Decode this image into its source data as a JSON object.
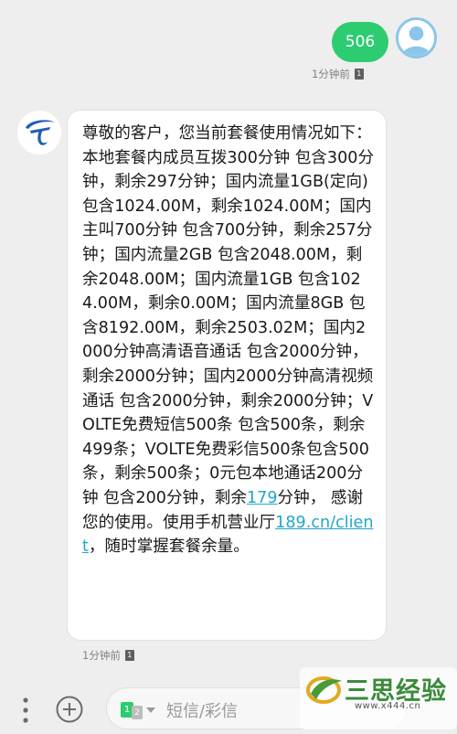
{
  "sent": {
    "text": "506",
    "time": "1分钟前",
    "sim": "1"
  },
  "received": {
    "segments": [
      {
        "t": "尊敬的客户，您当前套餐使用情况如下：本地套餐内成员互拨300分钟 包含300分钟，剩余297分钟；国内流量1GB(定向) 包含1024.00M，剩余1024.00M；国内主叫700分钟 包含700分钟，剩余257分钟；国内流量2GB 包含2048.00M，剩余2048.00M；国内流量1GB 包含1024.00M，剩余0.00M；国内流量8GB 包含8192.00M，剩余2503.02M；国内2000分钟高清语音通话 包含2000分钟，剩余2000分钟；国内2000分钟高清视频通话 包含2000分钟，剩余2000分钟；VOLTE免费短信500条 包含500条，剩余499条；VOLTE免费彩信500条包含500条，剩余500条；0元包本地通话200分钟 包含200分钟，剩余"
      },
      {
        "t": "179",
        "link": true
      },
      {
        "t": "分钟， 感谢您的使用。使用手机营业厅"
      },
      {
        "t": "189.cn/client",
        "link": true
      },
      {
        "t": "，随时掌握套餐余量。"
      }
    ],
    "time": "1分钟前",
    "sim": "1"
  },
  "composer": {
    "sim_active": "1",
    "sim_other": "2",
    "placeholder": "短信/彩信"
  },
  "watermark": {
    "title": "三思经验",
    "url": "www.x444.cn"
  },
  "colors": {
    "sent_bubble": "#2ecc71",
    "link": "#1fa8c9",
    "carrier_blue": "#1d5fb4"
  }
}
